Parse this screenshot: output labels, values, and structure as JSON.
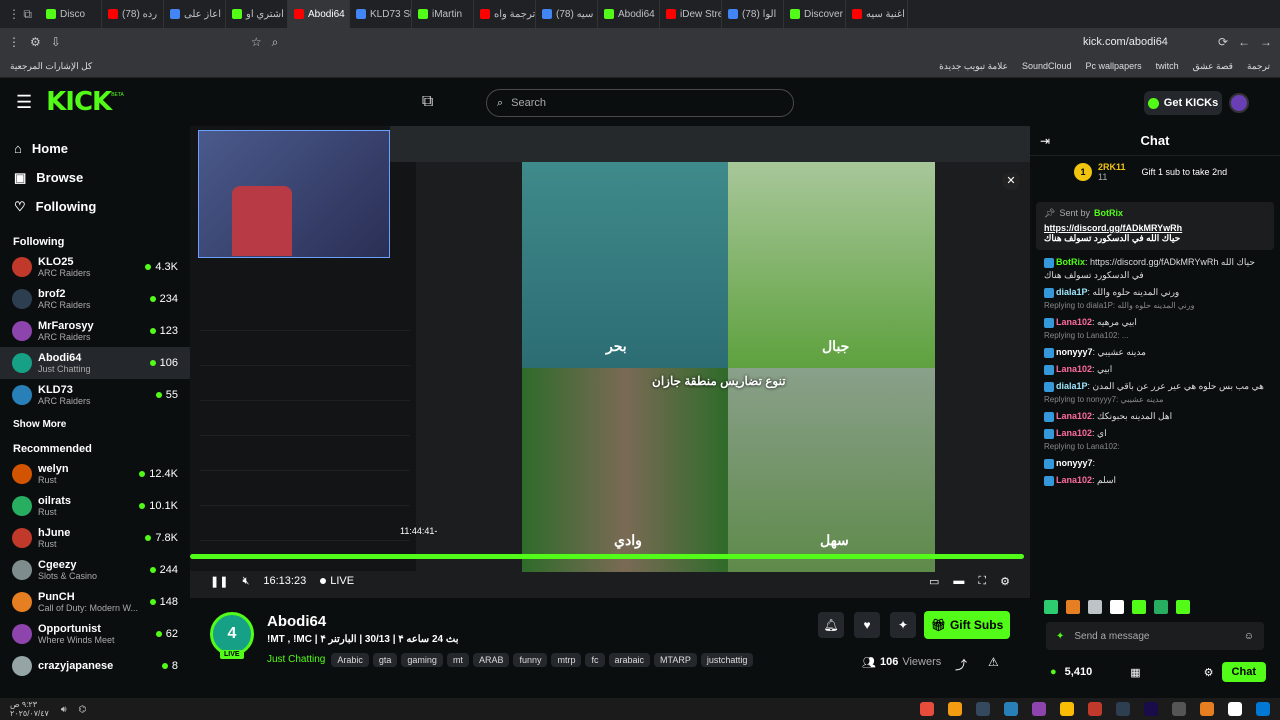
{
  "browser": {
    "tabs": [
      "Disco",
      "(78) رده",
      "اعاز على",
      "اشتري او",
      "Abodi64",
      "KLD73 Sl",
      "iMartin",
      "ترجمة واه",
      "(78) سيه",
      "Abodi64",
      "iDew Stre",
      "(78) الوا",
      "Discover",
      "اغنية سيه"
    ],
    "url": "kick.com/abodi64",
    "bookmarks_all": "كل الإشارات المرجعية",
    "bookmarks": [
      "علامة تبويب جديدة",
      "SoundCloud",
      "Pc wallpapers",
      "twitch",
      "قصة عشق",
      "ترجمة"
    ]
  },
  "header": {
    "logo": "KICK",
    "logo_sup": "BETA",
    "search_placeholder": "Search",
    "get_kicks": "Get KICKs"
  },
  "sidebar": {
    "nav": [
      {
        "label": "Home",
        "icon": "home-icon"
      },
      {
        "label": "Browse",
        "icon": "browse-icon"
      },
      {
        "label": "Following",
        "icon": "heart-icon"
      }
    ],
    "following_title": "Following",
    "following": [
      {
        "name": "KLO25",
        "cat": "ARC Raiders",
        "viewers": "4.3K",
        "color": "#c0392b"
      },
      {
        "name": "brof2",
        "cat": "ARC Raiders",
        "viewers": "234",
        "color": "#2c3e50"
      },
      {
        "name": "MrFarosyy",
        "cat": "ARC Raiders",
        "viewers": "123",
        "color": "#8e44ad"
      },
      {
        "name": "Abodi64",
        "cat": "Just Chatting",
        "viewers": "106",
        "color": "#16a085"
      },
      {
        "name": "KLD73",
        "cat": "ARC Raiders",
        "viewers": "55",
        "color": "#2980b9"
      }
    ],
    "show_more": "Show More",
    "recommended_title": "Recommended",
    "recommended": [
      {
        "name": "welyn",
        "cat": "Rust",
        "viewers": "12.4K",
        "color": "#d35400"
      },
      {
        "name": "oilrats",
        "cat": "Rust",
        "viewers": "10.1K",
        "color": "#27ae60"
      },
      {
        "name": "hJune",
        "cat": "Rust",
        "viewers": "7.8K",
        "color": "#c0392b"
      },
      {
        "name": "Cgeezy",
        "cat": "Slots & Casino",
        "viewers": "244",
        "color": "#7f8c8d"
      },
      {
        "name": "PunCH",
        "cat": "Call of Duty: Modern W...",
        "viewers": "148",
        "color": "#e67e22"
      },
      {
        "name": "Opportunist",
        "cat": "Where Winds Meet",
        "viewers": "62",
        "color": "#8e44ad"
      },
      {
        "name": "crazyjapanese",
        "cat": "",
        "viewers": "8",
        "color": "#95a5a6"
      }
    ]
  },
  "player": {
    "overlay_labels": [
      "بحر",
      "جبال",
      "وادي",
      "سهل"
    ],
    "overlay_caption": "تنوع تضاريس منطقة جازان",
    "tiktok_url": "tiktok.com/@jaz.515/video/7557400270543032329",
    "timestamp_overlay": "11:44:41-",
    "time": "16:13:23",
    "live": "LIVE",
    "progress": 1.0
  },
  "stream": {
    "name": "Abodi64",
    "title": "!MT , !MC | بث 24 ساعه ۴ | 30/13 | البارتنر ۴",
    "category": "Just Chatting",
    "tags": [
      "Arabic",
      "gta",
      "gaming",
      "mt",
      "ARAB",
      "funny",
      "mtrp",
      "fc",
      "arabaic",
      "MTARP",
      "justchattig"
    ],
    "viewers": "106",
    "viewers_label": "Viewers",
    "live_badge": "LIVE",
    "gift_subs": "Gift Subs"
  },
  "chat": {
    "title": "Chat",
    "pinned_user": "2RK11",
    "pinned_count": "11",
    "pinned_text": "Gift 1 sub to take 2nd",
    "sent_by": "Sent by",
    "bot": "BotRix",
    "pinned_msg_link": "https://discord.gg/fADkMRYwRh",
    "pinned_msg_text": "حياك الله في الدسكورد تسولف هناك",
    "messages": [
      {
        "reply": "",
        "user": "BotRix",
        "color": "#53fc18",
        "text": "https://discord.gg/fADkMRYwRh حياك الله في الدسكورد تسولف هناك"
      },
      {
        "reply": "",
        "user": "diala1P",
        "color": "#9fe8ff",
        "text": "ورني المدينه حلوه والله"
      },
      {
        "reply": "Replying to diala1P: ورني المدينه حلوه والله",
        "user": "Lana102",
        "color": "#ff6b9d",
        "text": "ابيي مرهيه"
      },
      {
        "reply": "Replying to Lana102: ...",
        "user": "nonyyy7",
        "color": "#ffffff",
        "text": "مدينه عشيبي"
      },
      {
        "reply": "",
        "user": "Lana102",
        "color": "#ff6b9d",
        "text": "ابيي"
      },
      {
        "reply": "",
        "user": "diala1P",
        "color": "#9fe8ff",
        "text": "هي مب بس حلوه هي عير عرر عن باقي المدن"
      },
      {
        "reply": "Replying to nonyyy7: مدينه عشيبي",
        "user": "Lana102",
        "color": "#ff6b9d",
        "text": "اهل المدينه بحبونكك"
      },
      {
        "reply": "",
        "user": "Lana102",
        "color": "#ff6b9d",
        "text": "اي"
      },
      {
        "reply": "Replying to Lana102:",
        "user": "nonyyy7",
        "color": "#ffffff",
        "text": ""
      },
      {
        "reply": "",
        "user": "Lana102",
        "color": "#ff6b9d",
        "text": "اسلم"
      }
    ],
    "placeholder": "Send a message",
    "points": "5,410",
    "chat_button": "Chat"
  },
  "taskbar": {
    "date": "٢٠٢٥/٠٧/٤٧",
    "time": "٩:٢٣ ص"
  }
}
